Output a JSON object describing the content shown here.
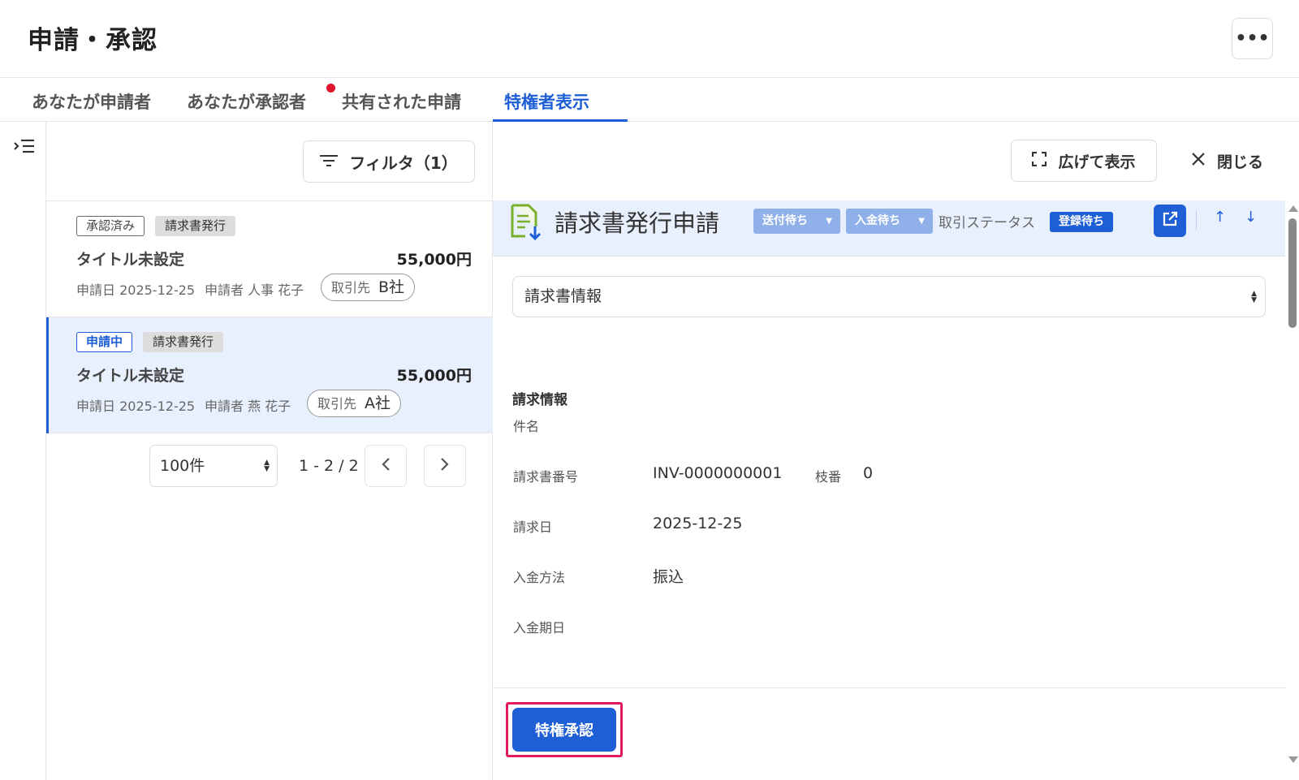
{
  "page": {
    "title": "申請・承認"
  },
  "tabs": [
    {
      "label": "あなたが申請者"
    },
    {
      "label": "あなたが承認者"
    },
    {
      "label": "共有された申請"
    },
    {
      "label": "特権者表示"
    }
  ],
  "list": {
    "filter_label": "フィルタ（1）",
    "items": [
      {
        "status_tag": "承認済み",
        "type_tag": "請求書発行",
        "title": "タイトル未設定",
        "amount": "55,000円",
        "applied_date": "申請日 2025-12-25",
        "applicant": "申請者 人事 花子",
        "partner_label": "取引先",
        "partner_value": "B社"
      },
      {
        "status_tag": "申請中",
        "type_tag": "請求書発行",
        "title": "タイトル未設定",
        "amount": "55,000円",
        "applied_date": "申請日 2025-12-25",
        "applicant": "申請者 燕 花子",
        "partner_label": "取引先",
        "partner_value": "A社"
      }
    ],
    "pagination": {
      "per_page": "100件",
      "range": "1 - 2 / 2"
    }
  },
  "detail": {
    "expand_label": "広げて表示",
    "close_label": "閉じる",
    "doc_title": "請求書発行申請",
    "chips": {
      "send_status": "送付待ち",
      "payment_status": "入金待ち"
    },
    "trade_status_label": "取引ステータス",
    "trade_status_badge": "登録待ち",
    "nav_up": "↑",
    "nav_down": "↓",
    "section_select": "請求書情報",
    "section_heading": "請求情報",
    "fields": {
      "subject_label": "件名",
      "invoice_no_label": "請求書番号",
      "invoice_no_value": "INV-0000000001",
      "branch_label": "枝番",
      "branch_value": "0",
      "invoice_date_label": "請求日",
      "invoice_date_value": "2025-12-25",
      "payment_method_label": "入金方法",
      "payment_method_value": "振込",
      "payment_due_label": "入金期日"
    },
    "approve_button": "特権承認"
  },
  "colors": {
    "accent": "#1f5fd6",
    "highlight": "#e5195f",
    "selected_bg": "#e8f0fd",
    "notification": "#e0152b"
  }
}
